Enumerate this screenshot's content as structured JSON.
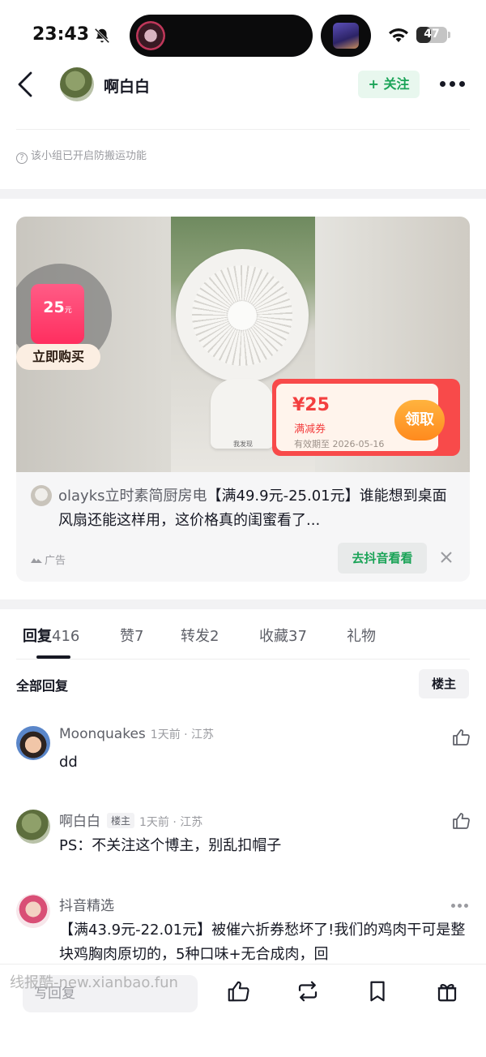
{
  "status_bar": {
    "time": "23:43",
    "battery_level": 0.47,
    "battery_text": "47"
  },
  "header": {
    "author_name": "啊白白",
    "follow_label": "+ 关注"
  },
  "notice": {
    "icon_text": "?",
    "text": "该小组已开启防搬运功能"
  },
  "ad": {
    "coupon_amount": "25",
    "coupon_unit": "元",
    "buy_now_label": "立即购买",
    "coupon_value": "¥25",
    "coupon_type": "满减券",
    "coupon_expire": "有效期至 2026-05-16",
    "claim_label": "领取",
    "image_caption": "我发现",
    "brand": "olayks立时素简厨房电",
    "title": "【满49.9元-25.01元】谁能想到桌面风扇还能这样用，这价格真的闺蜜看了...",
    "ad_label": "广告",
    "cta_label": "去抖音看看"
  },
  "tabs": [
    {
      "label": "回复",
      "count": "416",
      "active": true
    },
    {
      "label": "赞",
      "count": "7",
      "active": false
    },
    {
      "label": "转发",
      "count": "2",
      "active": false
    },
    {
      "label": "收藏",
      "count": "37",
      "active": false
    },
    {
      "label": "礼物",
      "count": "",
      "active": false
    }
  ],
  "replies": {
    "all_label": "全部回复",
    "owner_filter_label": "楼主"
  },
  "comments": [
    {
      "name": "Moonquakes",
      "badge": "",
      "meta": "1天前 · 江苏",
      "text": "dd"
    },
    {
      "name": "啊白白",
      "badge": "楼主",
      "meta": "1天前 · 江苏",
      "text": "PS：不关注这个博主，别乱扣帽子"
    },
    {
      "name": "抖音精选",
      "badge": "",
      "meta": "",
      "text": "【满43.9元-22.01元】被催六折券愁坏了!我们的鸡肉干可是整块鸡胸肉原切的，5种口味+无合成肉，回"
    }
  ],
  "bottom_bar": {
    "reply_placeholder": "写回复",
    "watermark": "线报酷-new.xianbao.fun"
  },
  "colors": {
    "accent_green": "#1aa357",
    "coupon_red": "#f84a4a",
    "claim_orange": "#ff8a1e"
  }
}
